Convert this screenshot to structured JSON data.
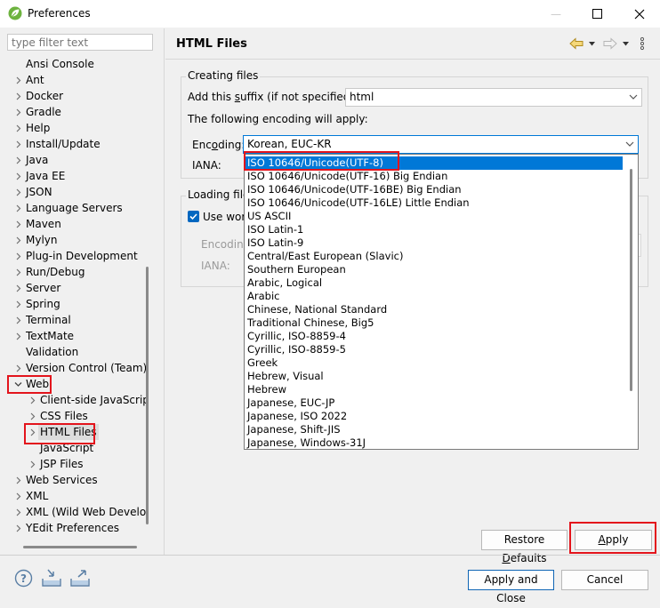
{
  "window": {
    "title": "Preferences",
    "minimize": "—",
    "maximize": "☐",
    "close": "✕"
  },
  "filter": {
    "placeholder": "type filter text"
  },
  "tree": [
    {
      "label": "Ansi Console",
      "chev": "",
      "indent": 0
    },
    {
      "label": "Ant",
      "chev": "right",
      "indent": 0
    },
    {
      "label": "Docker",
      "chev": "right",
      "indent": 0
    },
    {
      "label": "Gradle",
      "chev": "right",
      "indent": 0
    },
    {
      "label": "Help",
      "chev": "right",
      "indent": 0
    },
    {
      "label": "Install/Update",
      "chev": "right",
      "indent": 0
    },
    {
      "label": "Java",
      "chev": "right",
      "indent": 0
    },
    {
      "label": "Java EE",
      "chev": "right",
      "indent": 0
    },
    {
      "label": "JSON",
      "chev": "right",
      "indent": 0
    },
    {
      "label": "Language Servers",
      "chev": "right",
      "indent": 0
    },
    {
      "label": "Maven",
      "chev": "right",
      "indent": 0
    },
    {
      "label": "Mylyn",
      "chev": "right",
      "indent": 0
    },
    {
      "label": "Plug-in Development",
      "chev": "right",
      "indent": 0
    },
    {
      "label": "Run/Debug",
      "chev": "right",
      "indent": 0
    },
    {
      "label": "Server",
      "chev": "right",
      "indent": 0
    },
    {
      "label": "Spring",
      "chev": "right",
      "indent": 0
    },
    {
      "label": "Terminal",
      "chev": "right",
      "indent": 0
    },
    {
      "label": "TextMate",
      "chev": "right",
      "indent": 0
    },
    {
      "label": "Validation",
      "chev": "",
      "indent": 0
    },
    {
      "label": "Version Control (Team)",
      "chev": "right",
      "indent": 0
    },
    {
      "label": "Web",
      "chev": "down",
      "indent": 0
    },
    {
      "label": "Client-side JavaScript",
      "chev": "right",
      "indent": 1
    },
    {
      "label": "CSS Files",
      "chev": "right",
      "indent": 1
    },
    {
      "label": "HTML Files",
      "chev": "right",
      "indent": 1,
      "selected": true
    },
    {
      "label": "JavaScript",
      "chev": "",
      "indent": 1
    },
    {
      "label": "JSP Files",
      "chev": "right",
      "indent": 1
    },
    {
      "label": "Web Services",
      "chev": "right",
      "indent": 0
    },
    {
      "label": "XML",
      "chev": "right",
      "indent": 0
    },
    {
      "label": "XML (Wild Web Developer)",
      "chev": "right",
      "indent": 0
    },
    {
      "label": "YEdit Preferences",
      "chev": "right",
      "indent": 0
    }
  ],
  "page": {
    "title": "HTML Files"
  },
  "creating": {
    "legend": "Creating files",
    "suffix_label_pre": "Add this ",
    "suffix_label_mn": "s",
    "suffix_label_post": "uffix (if not specified):",
    "suffix_value": "html",
    "encoding_note": "The following encoding will apply:",
    "encoding_label_pre": "Enc",
    "encoding_label_mn": "o",
    "encoding_label_post": "ding:",
    "encoding_value": "Korean, EUC-KR",
    "iana_label": "IANA:"
  },
  "loading": {
    "legend": "Loading file",
    "use_workspace": "Use work",
    "encoding_label": "Encoding",
    "iana_label": "IANA:"
  },
  "dropdown": [
    "ISO 10646/Unicode(UTF-8)",
    "ISO 10646/Unicode(UTF-16) Big Endian",
    "ISO 10646/Unicode(UTF-16BE) Big Endian",
    "ISO 10646/Unicode(UTF-16LE) Little Endian",
    "US ASCII",
    "ISO Latin-1",
    "ISO Latin-9",
    "Central/East European (Slavic)",
    "Southern European",
    "Arabic, Logical",
    "Arabic",
    "Chinese, National Standard",
    "Traditional Chinese, Big5",
    "Cyrillic, ISO-8859-4",
    "Cyrillic, ISO-8859-5",
    "Greek",
    "Hebrew, Visual",
    "Hebrew",
    "Japanese, EUC-JP",
    "Japanese, ISO 2022",
    "Japanese, Shift-JIS",
    "Japanese, Windows-31J"
  ],
  "buttons": {
    "restore_pre": "Restore ",
    "restore_mn": "D",
    "restore_post": "efaults",
    "apply_pre": "",
    "apply_mn": "A",
    "apply_post": "pply",
    "apply_close": "Apply and Close",
    "cancel": "Cancel"
  },
  "colors": {
    "selection": "#0078d7",
    "highlight": "#e3141c",
    "accent": "#0f65b5"
  }
}
